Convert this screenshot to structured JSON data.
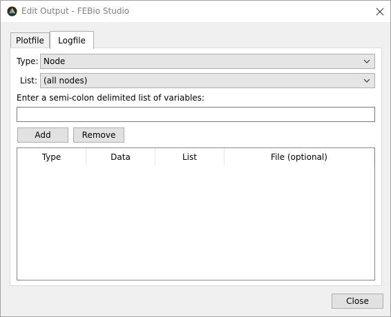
{
  "window": {
    "title": "Edit Output - FEBio Studio",
    "icon": "febio-studio-icon",
    "close_icon": "close-icon"
  },
  "tabs": [
    {
      "label": "Plotfile",
      "active": false
    },
    {
      "label": "Logfile",
      "active": true
    }
  ],
  "logfile": {
    "type_label": "Type:",
    "type_value": "Node",
    "list_label": "List:",
    "list_value": "(all nodes)",
    "variables_label": "Enter a semi-colon delimited list of variables:",
    "variables_value": "",
    "add_label": "Add",
    "remove_label": "Remove",
    "table": {
      "columns": [
        "Type",
        "Data",
        "List",
        "File (optional)"
      ],
      "rows": []
    }
  },
  "footer": {
    "close_label": "Close"
  }
}
